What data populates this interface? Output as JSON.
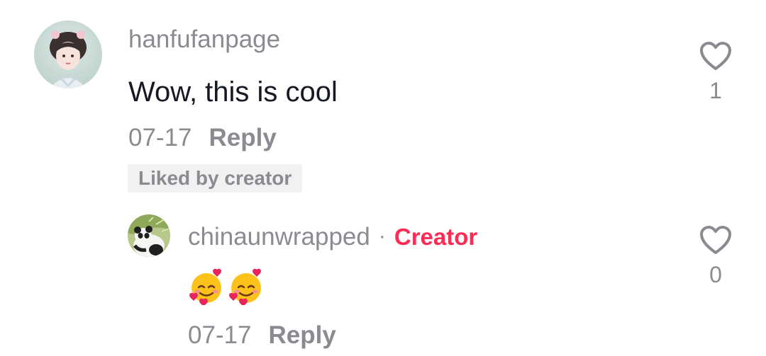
{
  "comments": [
    {
      "username": "hanfufanpage",
      "text": "Wow, this is cool",
      "date": "07-17",
      "reply_label": "Reply",
      "badge": "Liked by creator",
      "like_count": "1"
    }
  ],
  "reply": {
    "username": "chinaunwrapped",
    "separator": "·",
    "role_label": "Creator",
    "text": "🥰🥰",
    "date": "07-17",
    "reply_label": "Reply",
    "like_count": "0"
  },
  "colors": {
    "text_primary": "#161823",
    "text_secondary": "#8a8b91",
    "creator_accent": "#fe2c55",
    "badge_bg": "#f1f1f2"
  },
  "icons": {
    "like": "heart-outline-icon",
    "emoji": "smiling-face-with-hearts"
  }
}
